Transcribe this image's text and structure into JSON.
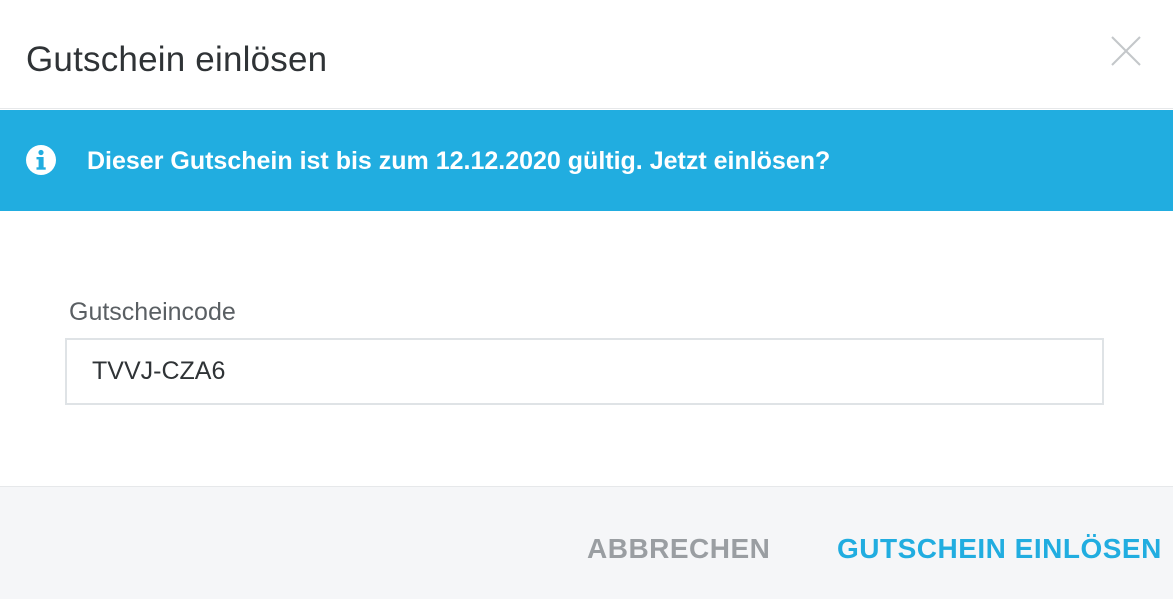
{
  "dialog": {
    "title": "Gutschein einlösen",
    "close_icon": "close-icon"
  },
  "info": {
    "icon": "info-icon",
    "message": "Dieser Gutschein ist bis zum 12.12.2020 gültig. Jetzt einlösen?",
    "color": "#21ade0"
  },
  "form": {
    "code_label": "Gutscheincode",
    "code_value": "TVVJ-CZA6"
  },
  "footer": {
    "cancel_label": "ABBRECHEN",
    "submit_label": "GUTSCHEIN EINLÖSEN"
  },
  "colors": {
    "accent": "#21ade0",
    "text_dark": "#2f3336",
    "muted": "#9a9ea2"
  }
}
